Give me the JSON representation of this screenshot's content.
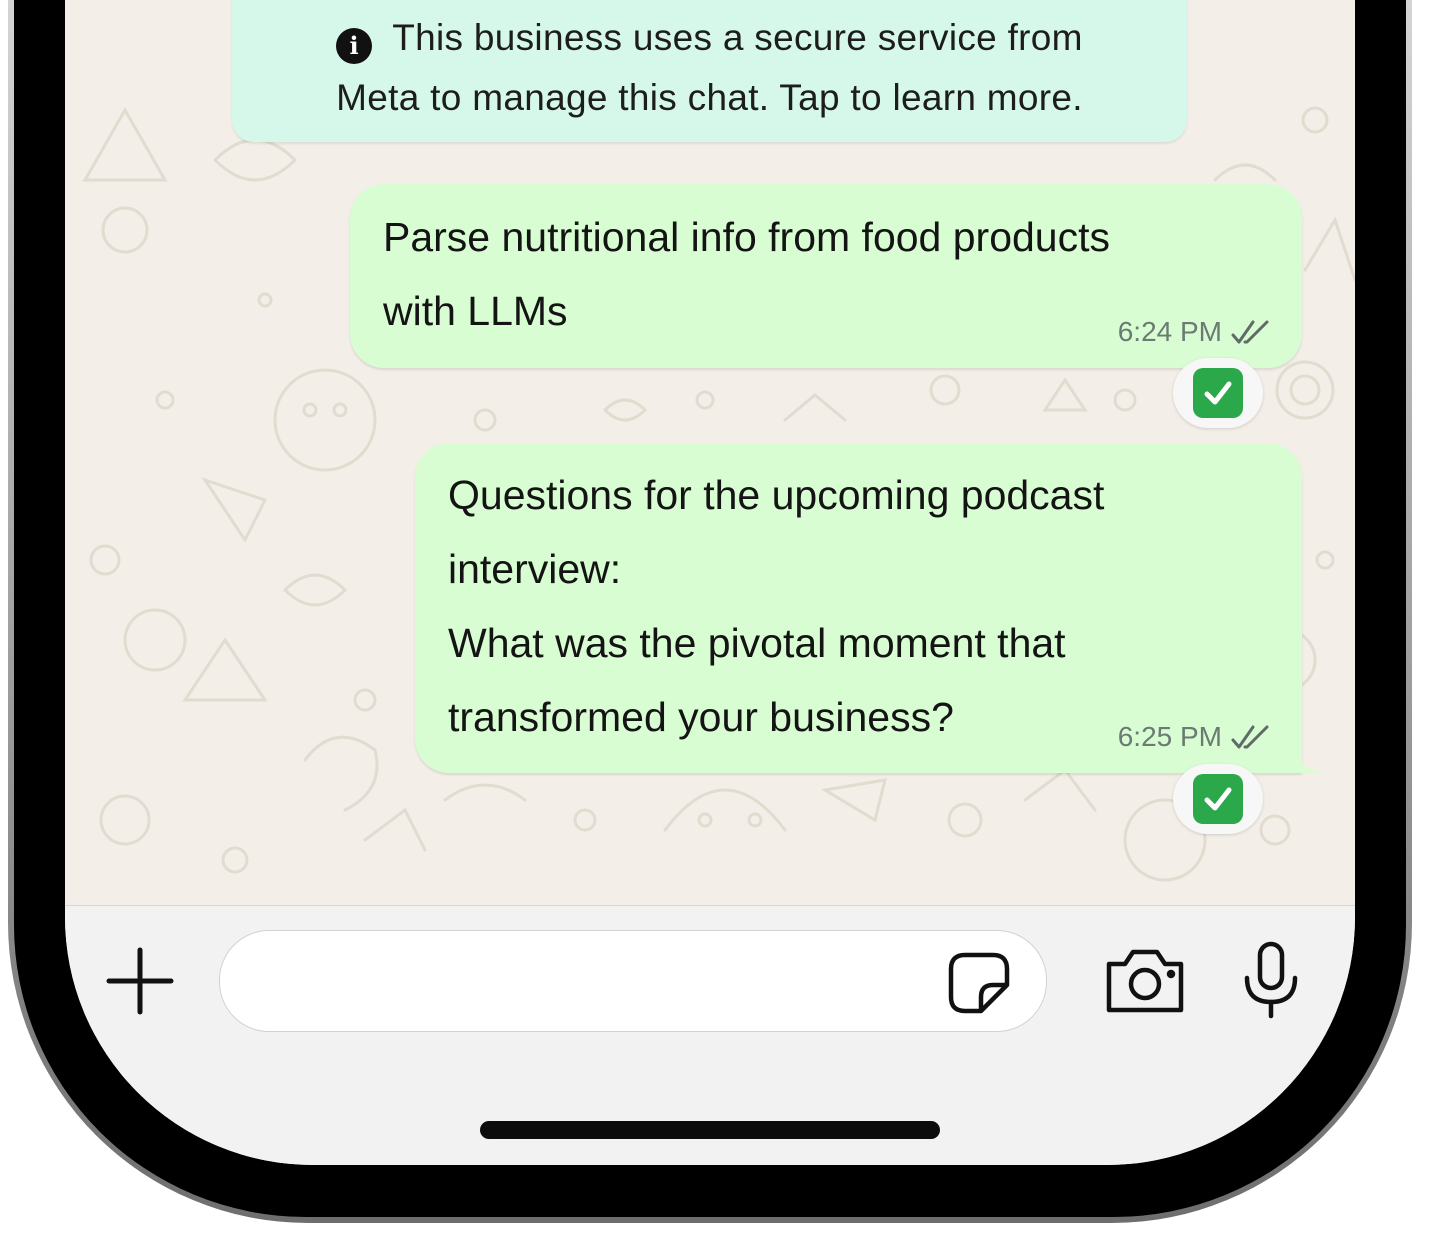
{
  "banner": {
    "icon": "info-icon",
    "line1": "This business uses a secure service from",
    "line2": "Meta to manage this chat. Tap to learn more."
  },
  "messages": [
    {
      "lines": [
        "Parse nutritional info from food products",
        "with LLMs"
      ],
      "time": "6:24 PM",
      "status": "double-check-icon",
      "reaction": "white-check-mark-emoji"
    },
    {
      "lines": [
        "Questions for the upcoming podcast",
        "interview:",
        "What was the pivotal moment that",
        "transformed your business?"
      ],
      "time": "6:25 PM",
      "status": "double-check-icon",
      "reaction": "white-check-mark-emoji"
    }
  ],
  "composer": {
    "placeholder": "",
    "icons": [
      "plus-icon",
      "sticker-icon",
      "camera-icon",
      "microphone-icon"
    ]
  },
  "colors": {
    "outgoing_bubble": "#d9fdd3",
    "banner_bg": "#d6f8ea",
    "chat_bg": "#f3efe8",
    "reaction_check": "#2aa84a"
  }
}
